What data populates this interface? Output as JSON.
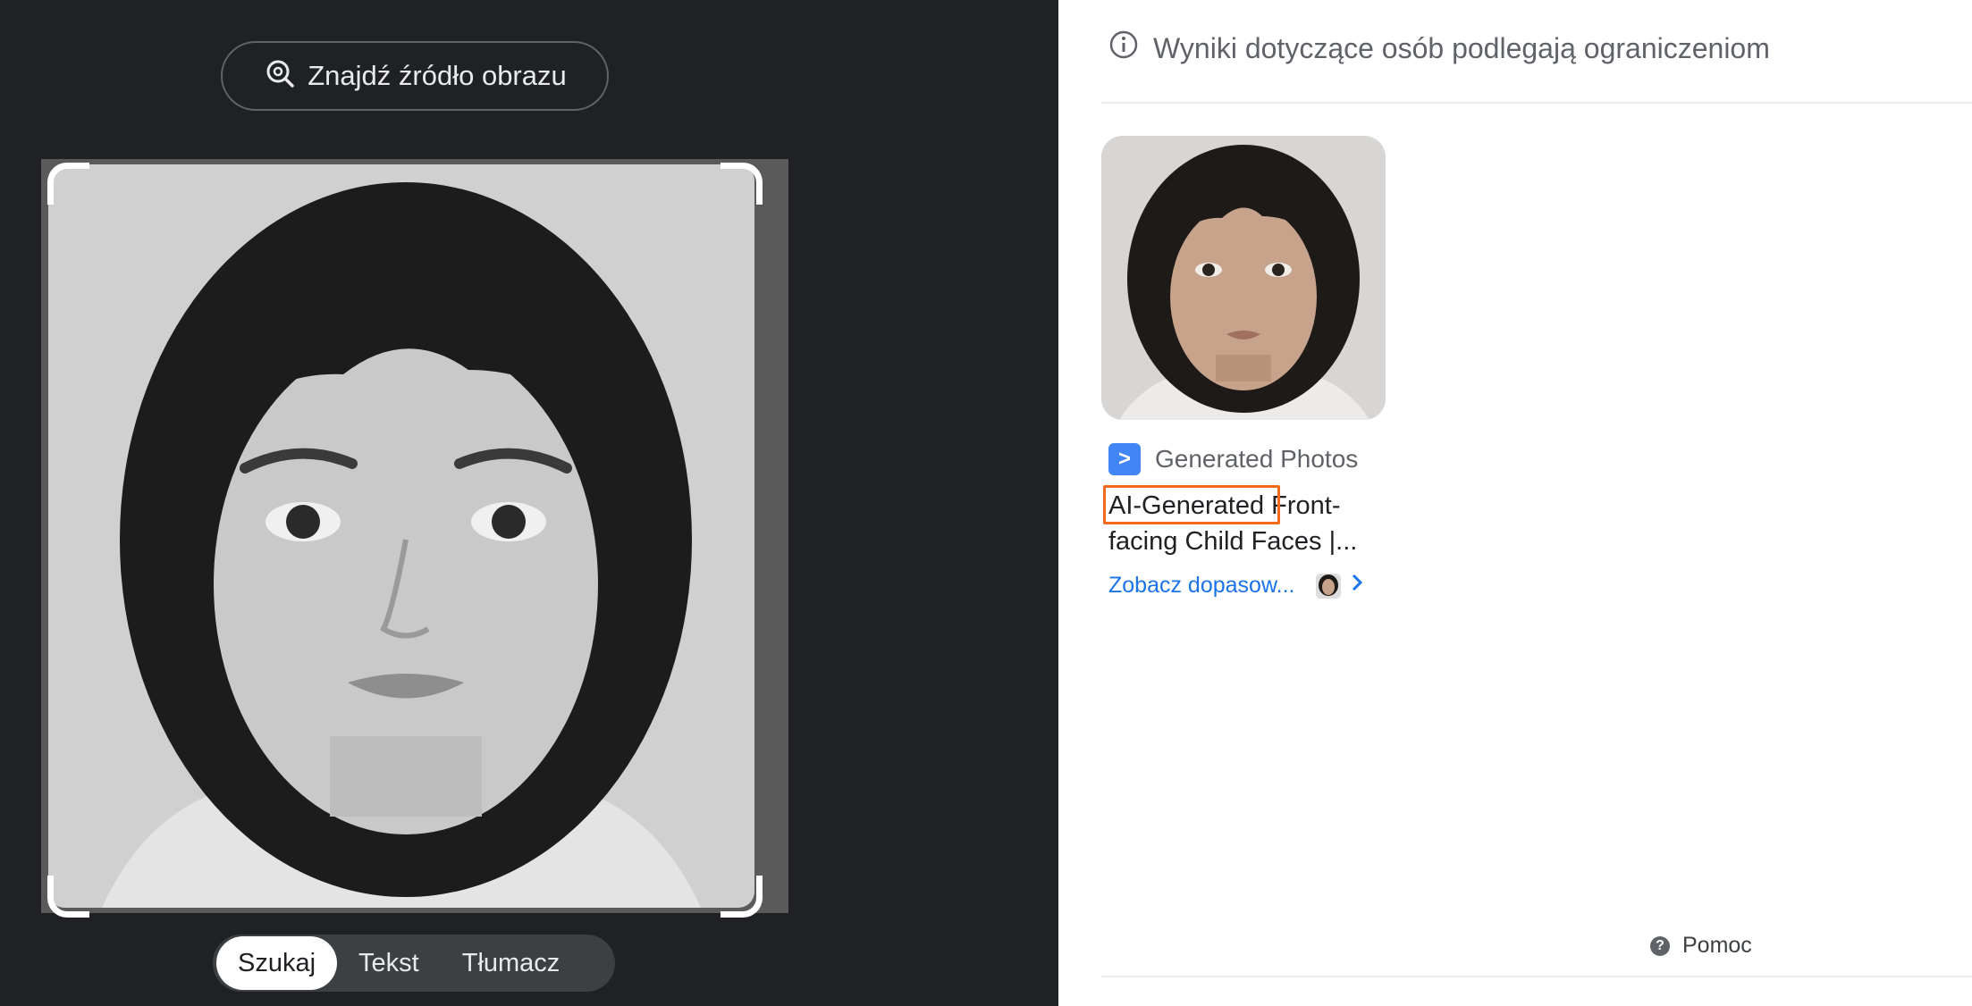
{
  "left": {
    "find_source_label": "Znajdź źródło obrazu",
    "tabs": [
      {
        "label": "Szukaj",
        "active": true
      },
      {
        "label": "Tekst",
        "active": false
      },
      {
        "label": "Tłumacz",
        "active": false
      }
    ]
  },
  "right": {
    "notice": "Wyniki dotyczące osób podlegają ograniczeniom",
    "result": {
      "source": "Generated Photos",
      "favicon_glyph": ">",
      "title_highlight": "AI-Generated",
      "title_line1_rest": "Front-",
      "title_line2": "facing Child Faces |...",
      "see_matches": "Zobacz dopasow..."
    },
    "help": "Pomoc"
  },
  "colors": {
    "left_bg": "#202124",
    "accent_blue": "#1a73e8",
    "highlight": "#f26b1d"
  }
}
